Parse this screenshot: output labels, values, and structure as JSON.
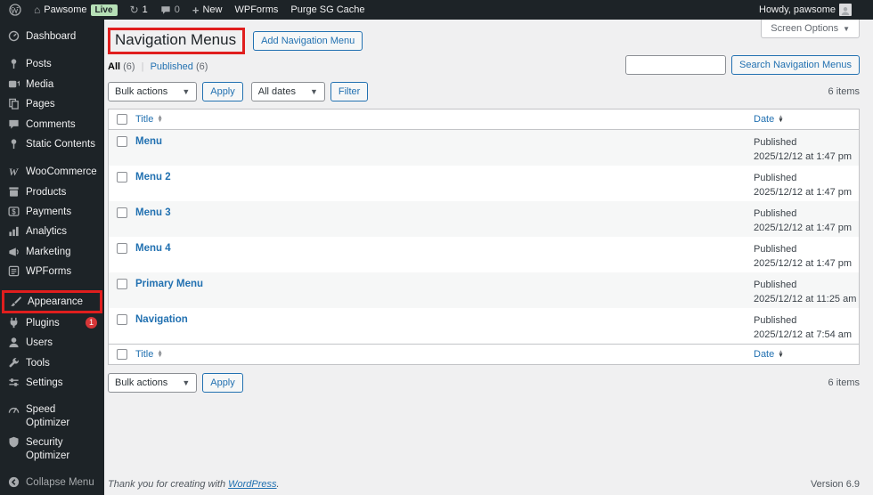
{
  "admin_bar": {
    "site_name": "Pawsome",
    "live_badge": "Live",
    "updates_count": "1",
    "comments_count": "0",
    "new_label": "New",
    "wpforms_label": "WPForms",
    "purge_label": "Purge SG Cache",
    "howdy": "Howdy, pawsome"
  },
  "sidebar": {
    "items": [
      {
        "label": "Dashboard"
      },
      {
        "label": "Posts"
      },
      {
        "label": "Media"
      },
      {
        "label": "Pages"
      },
      {
        "label": "Comments"
      },
      {
        "label": "Static Contents"
      },
      {
        "label": "WooCommerce"
      },
      {
        "label": "Products"
      },
      {
        "label": "Payments"
      },
      {
        "label": "Analytics"
      },
      {
        "label": "Marketing"
      },
      {
        "label": "WPForms"
      },
      {
        "label": "Appearance"
      },
      {
        "label": "Plugins",
        "badge": "1"
      },
      {
        "label": "Users"
      },
      {
        "label": "Tools"
      },
      {
        "label": "Settings"
      },
      {
        "label": "Speed Optimizer"
      },
      {
        "label": "Security Optimizer"
      },
      {
        "label": "Collapse Menu"
      }
    ]
  },
  "page": {
    "title": "Navigation Menus",
    "add_button": "Add Navigation Menu",
    "screen_options": "Screen Options",
    "views": {
      "all": "All",
      "all_count": "(6)",
      "sep": "|",
      "published": "Published",
      "published_count": "(6)"
    },
    "search_button": "Search Navigation Menus",
    "bulk_actions": "Bulk actions",
    "apply": "Apply",
    "all_dates": "All dates",
    "filter": "Filter",
    "items_count": "6 items"
  },
  "table": {
    "title_col": "Title",
    "date_col": "Date",
    "rows": [
      {
        "title": "Menu",
        "status": "Published",
        "date": "2025/12/12 at 1:47 pm"
      },
      {
        "title": "Menu 2",
        "status": "Published",
        "date": "2025/12/12 at 1:47 pm"
      },
      {
        "title": "Menu 3",
        "status": "Published",
        "date": "2025/12/12 at 1:47 pm"
      },
      {
        "title": "Menu 4",
        "status": "Published",
        "date": "2025/12/12 at 1:47 pm"
      },
      {
        "title": "Primary Menu",
        "status": "Published",
        "date": "2025/12/12 at 11:25 am"
      },
      {
        "title": "Navigation",
        "status": "Published",
        "date": "2025/12/12 at 7:54 am"
      }
    ]
  },
  "footer": {
    "thanks": "Thank you for creating with",
    "wordpress": "WordPress",
    "version": "Version 6.9"
  },
  "colors": {
    "accent": "#2271b1",
    "annotation_red": "#e01e1e",
    "badge_red": "#d63638",
    "live_green": "#b7e0b7",
    "chrome_dark": "#1d2327",
    "content_bg": "#f0f0f1",
    "row_stripe": "#f6f7f7"
  }
}
